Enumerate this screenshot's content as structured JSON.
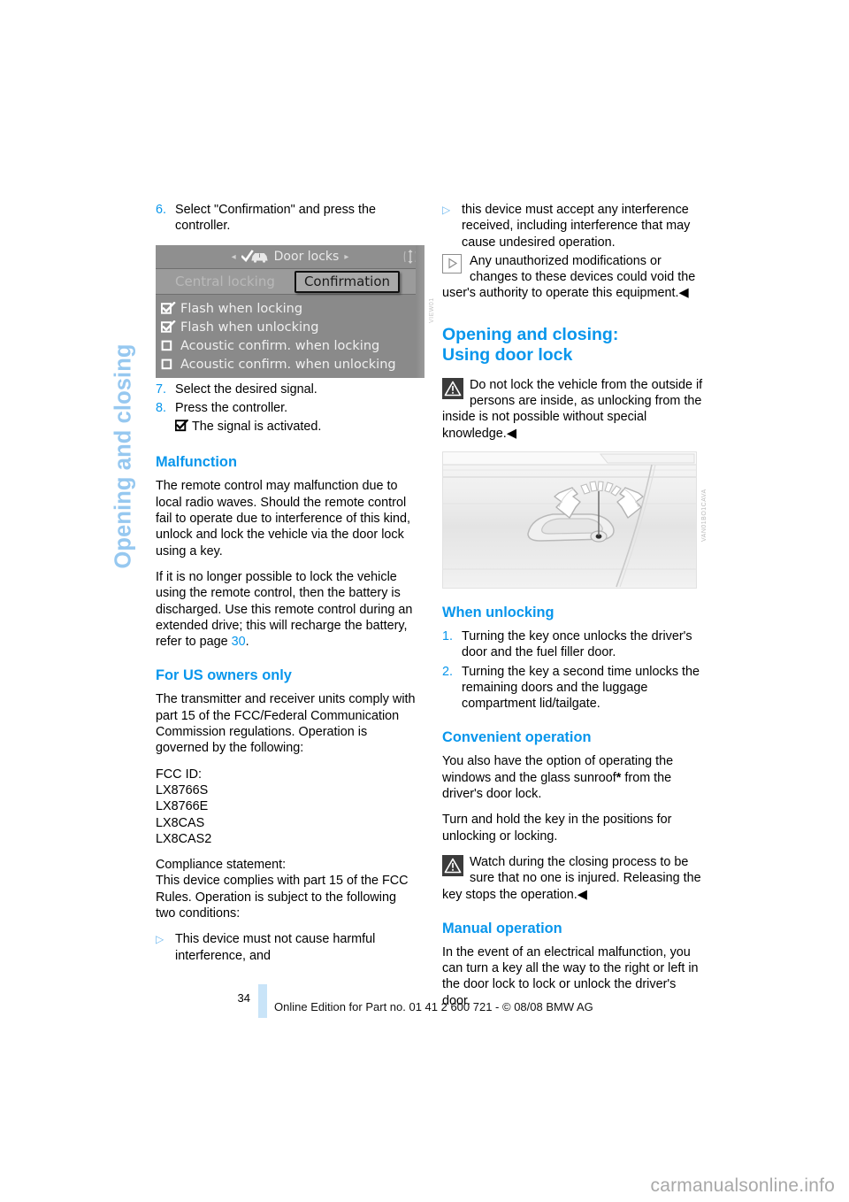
{
  "chapter": {
    "title": "Opening and closing",
    "accent": "#96c8f0"
  },
  "theme": {
    "heading_blue": "#0896ec",
    "bullet_blue": "#6fb8ee",
    "footer_bar": "#c9e4f8"
  },
  "left_column": {
    "step6": {
      "num": "6.",
      "text": "Select \"Confirmation\" and press the controller."
    },
    "idrive": {
      "title": "Door locks",
      "arrow_left": "◂",
      "arrow_right": "▸",
      "tab_inactive": "Central locking",
      "tab_active": "Confirmation",
      "items": [
        {
          "label": "Flash when locking",
          "checked": true
        },
        {
          "label": "Flash when unlocking",
          "checked": true
        },
        {
          "label": "Acoustic confirm. when locking",
          "checked": false
        },
        {
          "label": "Acoustic confirm. when unlocking",
          "checked": false
        }
      ],
      "caption": "VIEW01"
    },
    "step7": {
      "num": "7.",
      "text": "Select the desired signal."
    },
    "step8": {
      "num": "8.",
      "text": "Press the controller."
    },
    "step8_result": "The signal is activated.",
    "malfunction": {
      "heading": "Malfunction",
      "p1": "The remote control may malfunction due to local radio waves. Should the remote control fail to operate due to interference of this kind, unlock and lock the vehicle via the door lock using a key.",
      "p2_a": "If it is no longer possible to lock the vehicle using the remote control, then the battery is discharged. Use this remote control during an extended drive; this will recharge the battery, refer to page ",
      "p2_page": "30",
      "p2_b": "."
    },
    "us_owners": {
      "heading": "For US owners only",
      "p1": "The transmitter and receiver units comply with part 15 of the FCC/Federal Communication Commission regulations. Operation is governed by the following:",
      "fcc_label": "FCC ID:",
      "fcc_ids": [
        "LX8766S",
        "LX8766E",
        "LX8CAS",
        "LX8CAS2"
      ],
      "compliance_label": "Compliance statement:",
      "compliance_text": "This device complies with part 15 of the FCC Rules. Operation is subject to the following two conditions:",
      "bullet1": "This device must not cause harmful interference, and"
    }
  },
  "right_column": {
    "bullet2": "this device must accept any interference received, including interference that may cause undesired operation.",
    "note": {
      "icon": "note-triangle-icon",
      "text": "Any unauthorized modifications or changes to these devices could void the user's authority to operate this equipment.",
      "endmark": "◀"
    },
    "door_lock": {
      "heading_line1": "Opening and closing:",
      "heading_line2": "Using door lock",
      "warning": {
        "icon": "warning-triangle-icon",
        "text": "Do not lock the vehicle from the outside if persons are inside, as unlocking from the inside is not possible without special knowledge.",
        "endmark": "◀"
      },
      "image_caption": "VAN01BO1CAVA"
    },
    "when_unlocking": {
      "heading": "When unlocking",
      "steps": [
        {
          "num": "1.",
          "text": "Turning the key once unlocks the driver's door and the fuel filler door."
        },
        {
          "num": "2.",
          "text": "Turning the key a second time unlocks the remaining doors and the luggage compartment lid/tailgate."
        }
      ]
    },
    "convenient_operation": {
      "heading": "Convenient operation",
      "p1_a": "You also have the option of operating the windows and the glass sunroof",
      "p1_star": "*",
      "p1_b": " from the driver's door lock.",
      "p2": "Turn and hold the key in the positions for unlocking or locking.",
      "warning": {
        "icon": "warning-triangle-icon",
        "text": "Watch during the closing process to be sure that no one is injured. Releasing the key stops the operation.",
        "endmark": "◀"
      }
    },
    "manual_operation": {
      "heading": "Manual operation",
      "p1": "In the event of an electrical malfunction, you can turn a key all the way to the right or left in the door lock to lock or unlock the driver's door."
    }
  },
  "footer": {
    "page_number": "34",
    "credit": "Online Edition for Part no. 01 41 2 600 721 - © 08/08 BMW AG"
  },
  "watermark": "carmanualsonline.info"
}
